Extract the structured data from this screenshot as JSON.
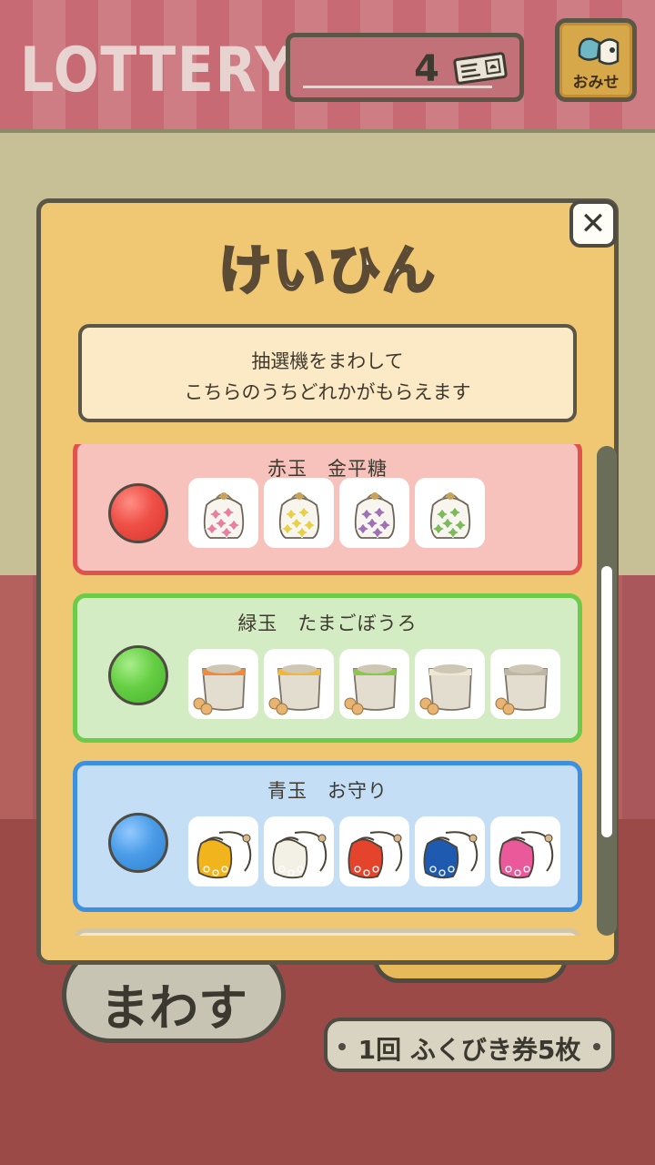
{
  "header": {
    "title": "LOTTERY",
    "ticket_count": "4",
    "shop_label": "おみせ"
  },
  "modal": {
    "title": "けいひん",
    "description_line1": "抽選機をまわして",
    "description_line2": "こちらのうちどれかがもらえます",
    "close_label": "✕",
    "prizes": [
      {
        "name": "赤玉　金平糖",
        "ball_color": "#ee4f46",
        "items": [
          "konpeito-pink",
          "konpeito-yellow",
          "konpeito-purple",
          "konpeito-green"
        ]
      },
      {
        "name": "緑玉　たまごぼうろ",
        "ball_color": "#66cf44",
        "items": [
          "bolo-orange",
          "bolo-yellow",
          "bolo-green",
          "bolo-white",
          "bolo-gray"
        ]
      },
      {
        "name": "青玉　お守り",
        "ball_color": "#4b9de8",
        "items": [
          "omamori-yellow",
          "omamori-white",
          "omamori-red",
          "omamori-blue",
          "omamori-pink"
        ]
      }
    ]
  },
  "footer": {
    "spin_label": "まわす",
    "cost_label": "1回 ふくびき券5枚"
  },
  "colors": {
    "konpeito": [
      "#e8809e",
      "#e8d04a",
      "#a072b4",
      "#7dbb5a"
    ],
    "bolo_band": [
      "#f08a3a",
      "#f0b83a",
      "#8ac84a",
      "#efe7d6",
      "#bdb6a4"
    ],
    "omamori": [
      "#f2b41c",
      "#f3f0e6",
      "#e4442b",
      "#1e5bb0",
      "#ea5a9a"
    ]
  }
}
